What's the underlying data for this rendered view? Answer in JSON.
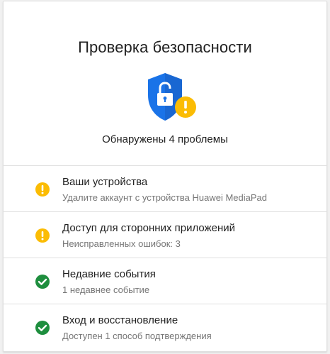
{
  "card": {
    "title": "Проверка безопасности",
    "hero_icon": "shield-lock-warning-icon",
    "summary": "Обнаружены 4 проблемы"
  },
  "colors": {
    "shield_blue": "#1a73e8",
    "warning_yellow": "#fbbc04",
    "ok_green": "#1e8e3e",
    "text_primary": "#212121",
    "text_secondary": "#757575",
    "divider": "#e0e0e0"
  },
  "items": [
    {
      "label": "Ваши устройства",
      "sub": "Удалите аккаунт с устройства Huawei MediaPad",
      "status": "warning",
      "icon": "warning-icon"
    },
    {
      "label": "Доступ для сторонних приложений",
      "sub": "Неисправленных ошибок: 3",
      "status": "warning",
      "icon": "warning-icon"
    },
    {
      "label": "Недавние события",
      "sub": "1 недавнее событие",
      "status": "ok",
      "icon": "check-icon"
    },
    {
      "label": "Вход и восстановление",
      "sub": "Доступен 1 способ подтверждения",
      "status": "ok",
      "icon": "check-icon"
    }
  ]
}
